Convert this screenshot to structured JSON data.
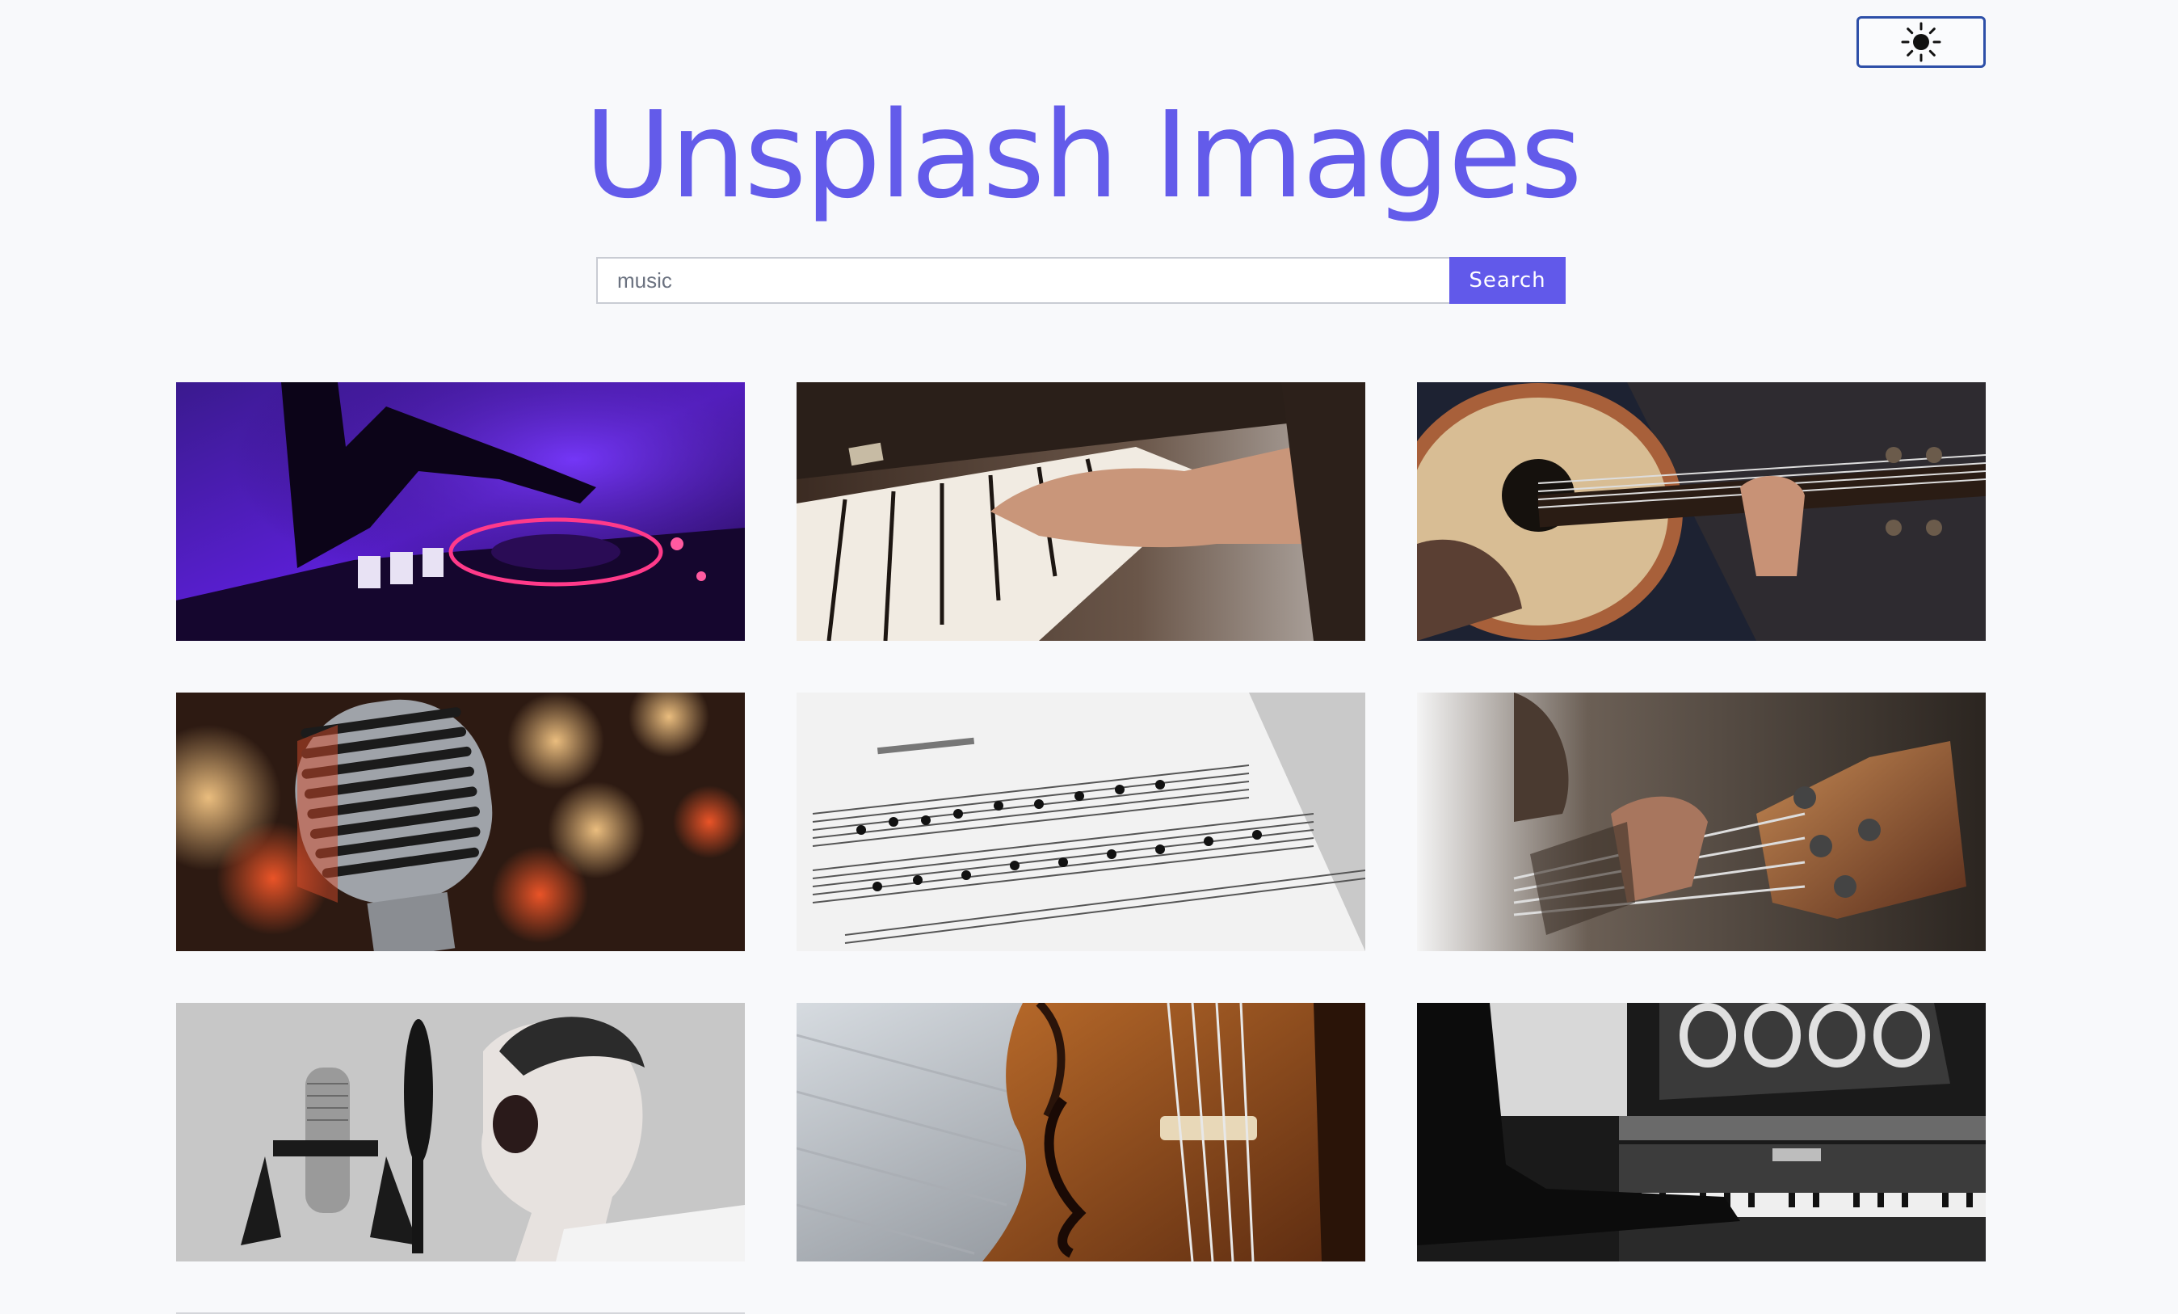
{
  "header": {
    "title": "Unsplash Images",
    "theme_toggle_icon": "sun-icon"
  },
  "search": {
    "value": "music",
    "placeholder": "",
    "button_label": "Search"
  },
  "colors": {
    "accent": "#635bea",
    "toggle_border": "#2d4fa8",
    "background": "#f8f9fb"
  },
  "results": [
    {
      "subject": "dj-controller"
    },
    {
      "subject": "piano-hands"
    },
    {
      "subject": "acoustic-guitar"
    },
    {
      "subject": "vintage-microphone"
    },
    {
      "subject": "sheet-music"
    },
    {
      "subject": "bass-guitar"
    },
    {
      "subject": "singer-with-microphone"
    },
    {
      "subject": "violin"
    },
    {
      "subject": "upright-piano"
    }
  ]
}
